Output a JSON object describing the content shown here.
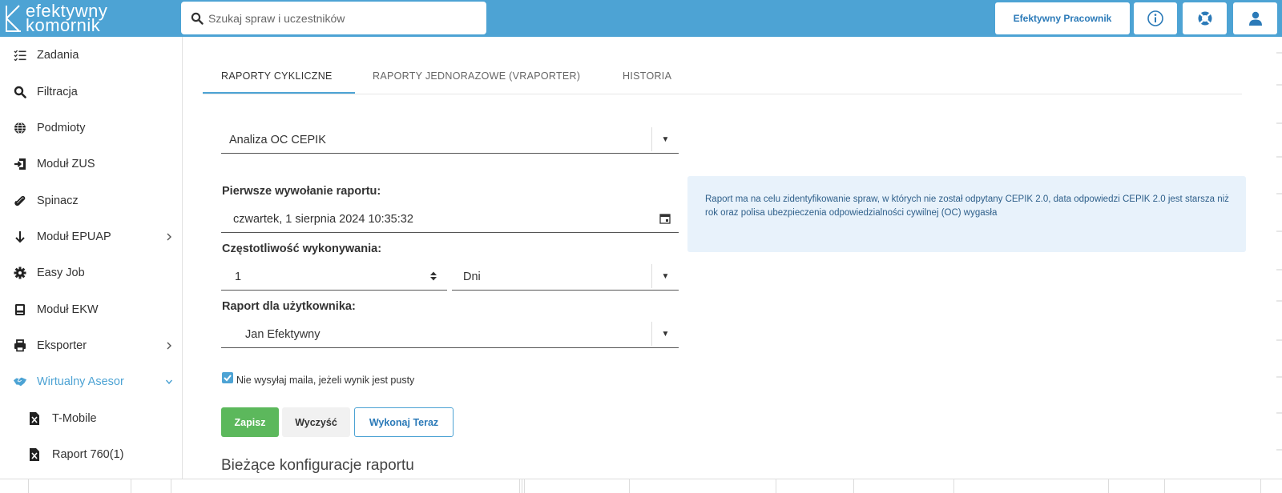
{
  "brand": {
    "line1": "efektywny",
    "line2": "komornik"
  },
  "search": {
    "placeholder": "Szukaj spraw i uczestników"
  },
  "header": {
    "employee_label": "Efektywny Pracownik"
  },
  "sidebar": {
    "items": [
      {
        "label": "Zadania",
        "icon": "tasks-list-icon"
      },
      {
        "label": "Filtracja",
        "icon": "search-icon"
      },
      {
        "label": "Podmioty",
        "icon": "globe-icon"
      },
      {
        "label": "Moduł ZUS",
        "icon": "sign-in-icon"
      },
      {
        "label": "Spinacz",
        "icon": "paperclip-icon"
      },
      {
        "label": "Moduł EPUAP",
        "icon": "arrow-down-icon",
        "expandable": true
      },
      {
        "label": "Easy Job",
        "icon": "gear-icon"
      },
      {
        "label": "Moduł EKW",
        "icon": "book-icon"
      },
      {
        "label": "Eksporter",
        "icon": "printer-icon",
        "expandable": true
      },
      {
        "label": "Wirtualny Asesor",
        "icon": "handshake-icon",
        "expanded": true,
        "active": true
      },
      {
        "label": "T-Mobile",
        "icon": "excel-file-icon",
        "sub": true
      },
      {
        "label": "Raport 760(1)",
        "icon": "excel-file-icon",
        "sub": true
      }
    ]
  },
  "tabs": [
    {
      "label": "RAPORTY CYKLICZNE",
      "active": true
    },
    {
      "label": "RAPORTY JEDNORAZOWE (VRAPORTER)"
    },
    {
      "label": "HISTORIA"
    }
  ],
  "form": {
    "report_select": "Analiza OC CEPIK",
    "first_call_label": "Pierwsze wywołanie raportu:",
    "first_call_value": "czwartek, 1 sierpnia 2024 10:35:32",
    "frequency_label": "Częstotliwość wykonywania:",
    "frequency_value": "1",
    "frequency_unit": "Dni",
    "user_label": "Raport dla użytkownika:",
    "user_value": "Jan Efektywny",
    "no_mail_label": "Nie wysyłaj maila, jeżeli wynik jest pusty",
    "no_mail_checked": true
  },
  "info": {
    "text": "Raport ma na celu zidentyfikowanie spraw, w których nie został odpytany CEPIK 2.0, data odpowiedzi CEPIK 2.0 jest starsza niż rok oraz polisa ubezpieczenia odpowiedzialności cywilnej (OC) wygasła"
  },
  "buttons": {
    "save": "Zapisz",
    "clear": "Wyczyść",
    "run_now": "Wykonaj Teraz"
  },
  "current_config": {
    "title": "Bieżące konfiguracje raportu"
  },
  "colors": {
    "accent": "#4da3d4",
    "save": "#5cb85c",
    "info_bg": "#e8f2fb"
  }
}
